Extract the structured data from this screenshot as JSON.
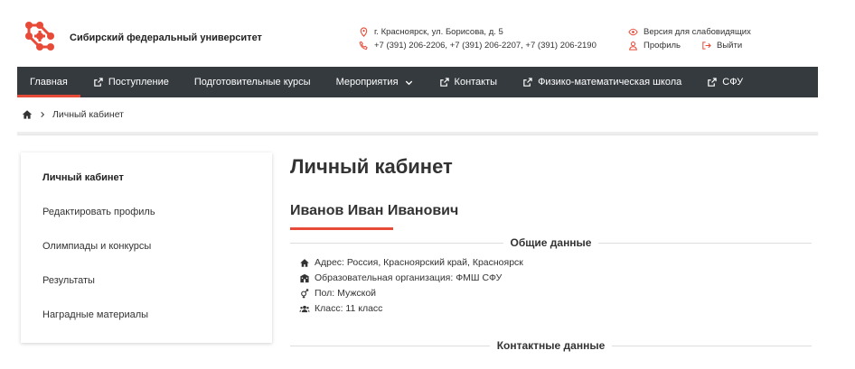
{
  "header": {
    "brand": "Сибирский федеральный университет",
    "address": "г. Красноярск, ул. Борисова, д. 5",
    "phones": "+7 (391) 206-2206, +7 (391) 206-2207, +7 (391) 206-2190",
    "accessibility": "Версия для слабовидящих",
    "profile": "Профиль",
    "logout": "Выйти",
    "accent_color": "#e84a38"
  },
  "nav": {
    "items": [
      {
        "label": "Главная"
      },
      {
        "label": "Поступление"
      },
      {
        "label": "Подготовительные курсы"
      },
      {
        "label": "Мероприятия"
      },
      {
        "label": "Контакты"
      },
      {
        "label": "Физико-математическая школа"
      },
      {
        "label": "СФУ"
      }
    ],
    "background": "#353a3f"
  },
  "breadcrumb": {
    "current": "Личный кабинет"
  },
  "sidebar": {
    "items": [
      {
        "label": "Личный кабинет"
      },
      {
        "label": "Редактировать профиль"
      },
      {
        "label": "Олимпиады и конкурсы"
      },
      {
        "label": "Результаты"
      },
      {
        "label": "Наградные материалы"
      }
    ]
  },
  "main": {
    "title": "Личный кабинет",
    "user_name": "Иванов Иван Иванович",
    "general_heading": "Общие данные",
    "address": "Адрес: Россия, Красноярский край, Красноярск",
    "organization": "Образовательная организация: ФМШ СФУ",
    "gender": "Пол: Мужской",
    "grade": "Класс: 11 класс",
    "contact_heading": "Контактные данные"
  }
}
